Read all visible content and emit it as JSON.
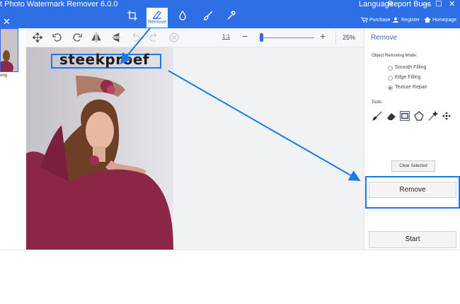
{
  "titlebar": {
    "app_title": "t Photo Watermark Remover 6.0.0",
    "language": "Language",
    "report_bugs": "Report Bugs",
    "minimize": "—",
    "maximize": "☐",
    "close": "✕",
    "close_left": "✕",
    "purchase": "Purchase",
    "register": "Register",
    "homepage": "Homepage",
    "modes": [
      "crop-icon",
      "remove-icon",
      "drop-icon",
      "brush-icon",
      "wrench-icon"
    ],
    "remove_label": "Remove"
  },
  "left_strip": {
    "thumb_label": "ong"
  },
  "toolbar": {
    "ratio": "1:1",
    "zoom_minus": "−",
    "zoom_plus": "+",
    "zoom_value": "25%",
    "zoom_level": 0.02
  },
  "canvas": {
    "watermark_text": "steekproef"
  },
  "panel": {
    "title": "Remove",
    "mode_label": "Object Removing Mode:",
    "modes": [
      {
        "label": "Smooth Filling",
        "selected": false
      },
      {
        "label": "Edge Filling",
        "selected": false
      },
      {
        "label": "Texture Repair",
        "selected": true
      }
    ],
    "tools_label": "Tools:",
    "tools": [
      "brush-icon",
      "eraser-icon",
      "rectangle-select-icon",
      "polygon-select-icon",
      "magic-wand-icon",
      "move-icon"
    ],
    "clear_selected": "Clear Selected",
    "remove": "Remove",
    "start": "Start"
  },
  "colors": {
    "accent": "#2f6fe6",
    "highlight": "#1a7ae6"
  }
}
